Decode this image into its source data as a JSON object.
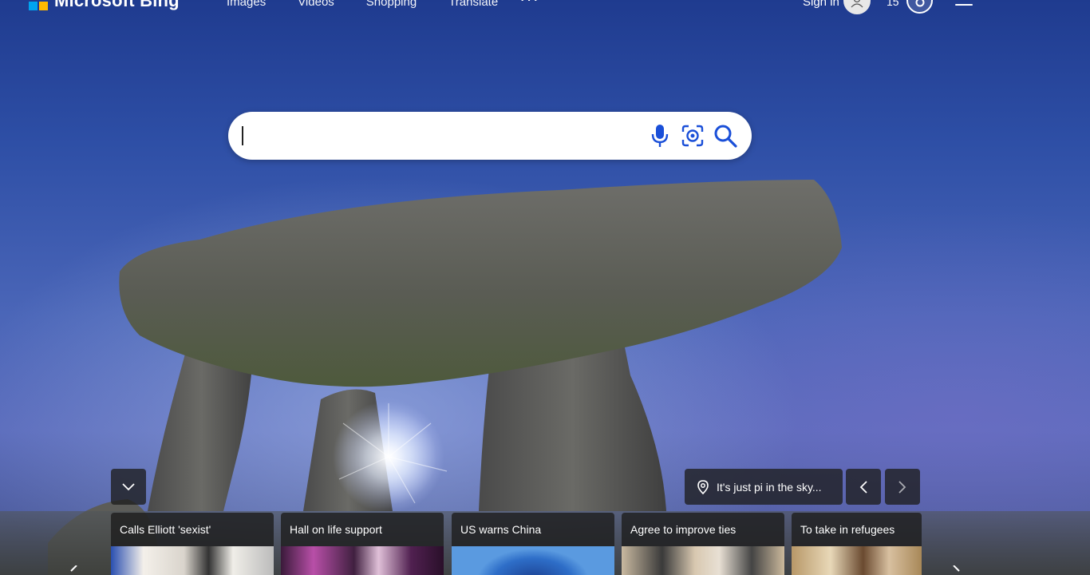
{
  "topbar": {
    "logo_text": "Microsoft Bing",
    "nav": [
      "Images",
      "Videos",
      "Shopping",
      "Translate"
    ],
    "more": "···",
    "signin": "Sign in",
    "points": "15"
  },
  "search": {
    "value": "",
    "placeholder": ""
  },
  "location": {
    "label": "It's just pi in the sky..."
  },
  "cards": [
    {
      "title": "Calls Elliott 'sexist'"
    },
    {
      "title": "Hall on life support"
    },
    {
      "title": "US warns China"
    },
    {
      "title": "Agree to improve ties"
    },
    {
      "title": "To take in refugees"
    }
  ],
  "colors": {
    "ms_red": "#f25022",
    "ms_green": "#7fba00",
    "ms_blue": "#00a4ef",
    "ms_yellow": "#ffb900",
    "search_icon": "#1a4fd8"
  },
  "icons": {
    "mic": "microphone-icon",
    "visual": "visual-search-icon",
    "search": "search-icon",
    "location": "location-pin-icon"
  }
}
